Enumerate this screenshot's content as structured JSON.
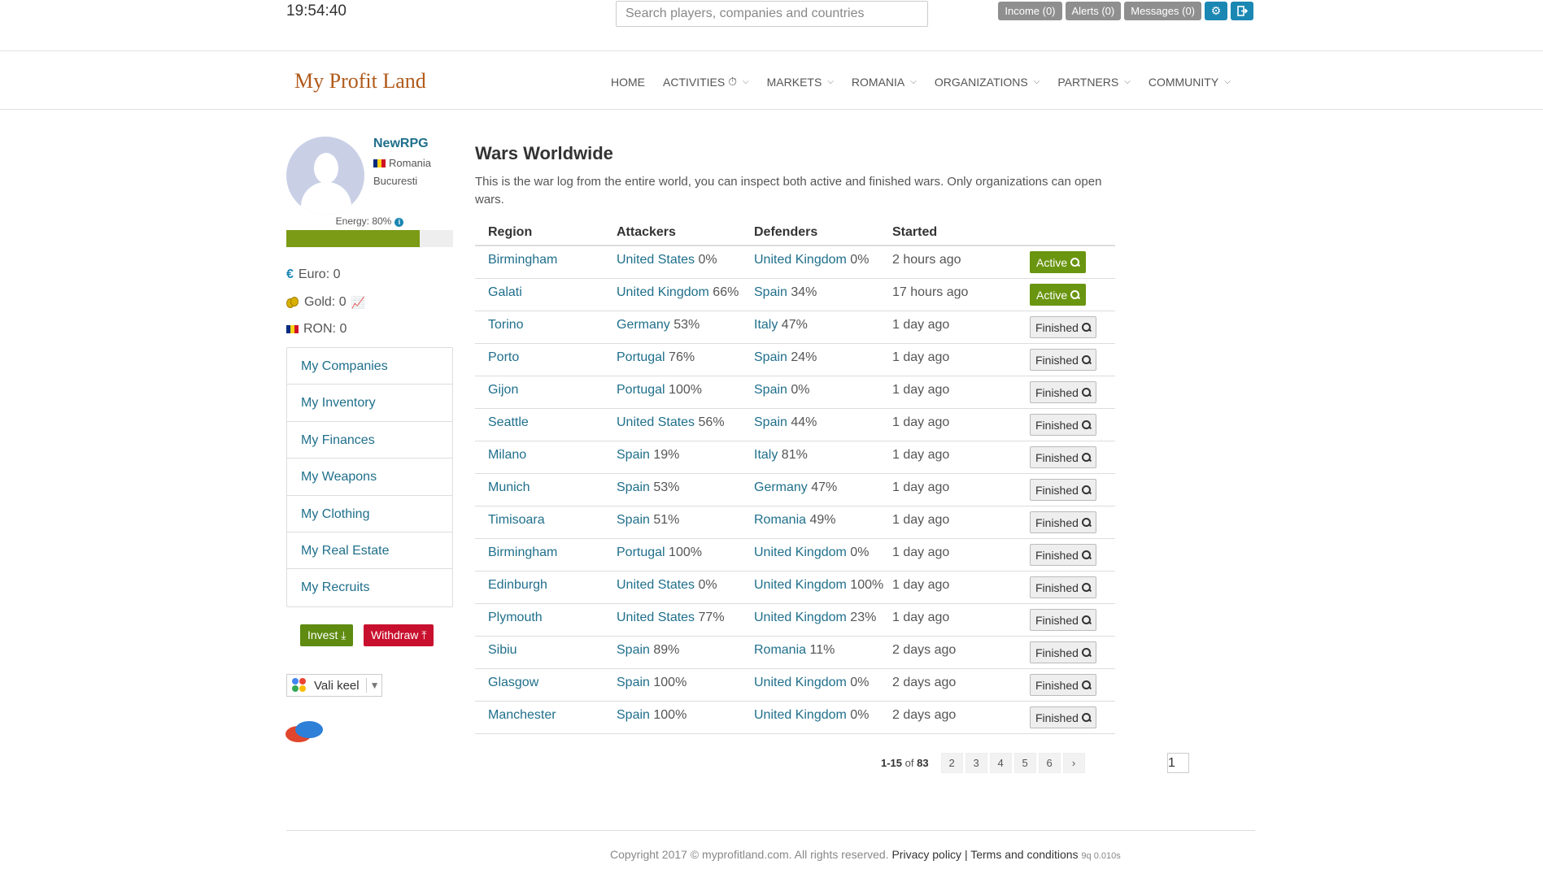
{
  "topbar": {
    "clock": "19:54:40",
    "search_placeholder": "Search players, companies and countries",
    "income": "Income (0)",
    "alerts": "Alerts (0)",
    "messages": "Messages (0)"
  },
  "nav": {
    "logo": "My Profit Land",
    "items": [
      "HOME",
      "ACTIVITIES",
      "MARKETS",
      "ROMANIA",
      "ORGANIZATIONS",
      "PARTNERS",
      "COMMUNITY"
    ]
  },
  "profile": {
    "username": "NewRPG",
    "country": "Romania",
    "city": "Bucuresti",
    "energy_label": "Energy: 80%",
    "energy_value": 0.8,
    "euro": "Euro: 0",
    "gold": "Gold: 0",
    "ron": "RON: 0"
  },
  "sidebar": {
    "menu": [
      "My Companies",
      "My Inventory",
      "My Finances",
      "My Weapons",
      "My Clothing",
      "My Real Estate",
      "My Recruits"
    ],
    "invest": "Invest",
    "withdraw": "Withdraw",
    "language": "Vali keel"
  },
  "main": {
    "title": "Wars Worldwide",
    "description": "This is the war log from the entire world, you can inspect both active and finished wars. Only organizations can open wars.",
    "columns": [
      "Region",
      "Attackers",
      "Defenders",
      "Started"
    ],
    "rows": [
      {
        "region": "Birmingham",
        "att": "United States",
        "att_pct": "0%",
        "def": "United Kingdom",
        "def_pct": "0%",
        "started": "2 hours ago",
        "status": "Active"
      },
      {
        "region": "Galati",
        "att": "United Kingdom",
        "att_pct": "66%",
        "def": "Spain",
        "def_pct": "34%",
        "started": "17 hours ago",
        "status": "Active"
      },
      {
        "region": "Torino",
        "att": "Germany",
        "att_pct": "53%",
        "def": "Italy",
        "def_pct": "47%",
        "started": "1 day ago",
        "status": "Finished"
      },
      {
        "region": "Porto",
        "att": "Portugal",
        "att_pct": "76%",
        "def": "Spain",
        "def_pct": "24%",
        "started": "1 day ago",
        "status": "Finished"
      },
      {
        "region": "Gijon",
        "att": "Portugal",
        "att_pct": "100%",
        "def": "Spain",
        "def_pct": "0%",
        "started": "1 day ago",
        "status": "Finished"
      },
      {
        "region": "Seattle",
        "att": "United States",
        "att_pct": "56%",
        "def": "Spain",
        "def_pct": "44%",
        "started": "1 day ago",
        "status": "Finished"
      },
      {
        "region": "Milano",
        "att": "Spain",
        "att_pct": "19%",
        "def": "Italy",
        "def_pct": "81%",
        "started": "1 day ago",
        "status": "Finished"
      },
      {
        "region": "Munich",
        "att": "Spain",
        "att_pct": "53%",
        "def": "Germany",
        "def_pct": "47%",
        "started": "1 day ago",
        "status": "Finished"
      },
      {
        "region": "Timisoara",
        "att": "Spain",
        "att_pct": "51%",
        "def": "Romania",
        "def_pct": "49%",
        "started": "1 day ago",
        "status": "Finished"
      },
      {
        "region": "Birmingham",
        "att": "Portugal",
        "att_pct": "100%",
        "def": "United Kingdom",
        "def_pct": "0%",
        "started": "1 day ago",
        "status": "Finished"
      },
      {
        "region": "Edinburgh",
        "att": "United States",
        "att_pct": "0%",
        "def": "United Kingdom",
        "def_pct": "100%",
        "started": "1 day ago",
        "status": "Finished"
      },
      {
        "region": "Plymouth",
        "att": "United States",
        "att_pct": "77%",
        "def": "United Kingdom",
        "def_pct": "23%",
        "started": "1 day ago",
        "status": "Finished"
      },
      {
        "region": "Sibiu",
        "att": "Spain",
        "att_pct": "89%",
        "def": "Romania",
        "def_pct": "11%",
        "started": "2 days ago",
        "status": "Finished"
      },
      {
        "region": "Glasgow",
        "att": "Spain",
        "att_pct": "100%",
        "def": "United Kingdom",
        "def_pct": "0%",
        "started": "2 days ago",
        "status": "Finished"
      },
      {
        "region": "Manchester",
        "att": "Spain",
        "att_pct": "100%",
        "def": "United Kingdom",
        "def_pct": "0%",
        "started": "2 days ago",
        "status": "Finished"
      }
    ],
    "pagination": {
      "range": "1-15",
      "of": "of",
      "total": "83",
      "pages": [
        "1",
        "2",
        "3",
        "4",
        "5",
        "6"
      ],
      "next": "›"
    }
  },
  "footer": {
    "copyright": "Copyright 2017 © myprofitland.com. All rights reserved.",
    "privacy": "Privacy policy",
    "separator": "|",
    "terms": "Terms and conditions",
    "stats": "9q 0.010s"
  },
  "colors": {
    "accent": "#1b87b3",
    "link": "#1f6f8b",
    "active_green": "#6a9510",
    "withdraw_red": "#c8102e",
    "logo": "#b0591a"
  }
}
